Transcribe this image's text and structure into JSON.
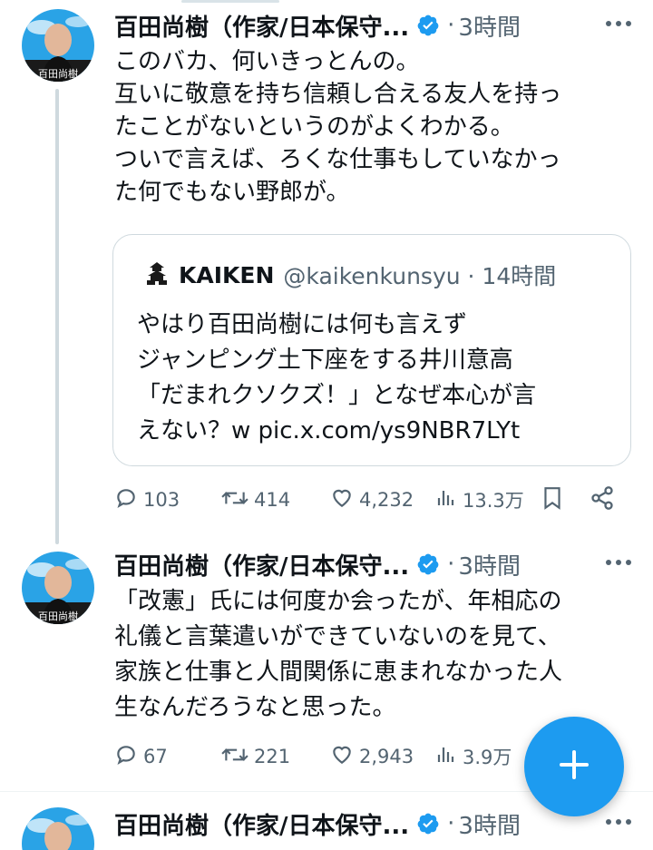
{
  "tweets": [
    {
      "author_name": "百田尚樹（作家/日本保守...",
      "time": "3時間",
      "lines": [
        "このバカ、何いきっとんの。",
        "互いに敬意を持ち信頼し合える友人を持っ",
        "たことがないというのがよくわかる。",
        "ついで言えば、ろくな仕事もしていなかっ",
        "た何でもない野郎が。"
      ],
      "quote": {
        "name": "KAIKEN",
        "handle": "@kaikenkunsyu · 14時間",
        "lines": [
          "やはり百田尚樹には何も言えず",
          "ジャンピング土下座をする井川意高",
          "「だまれクソクズ！」となぜ本心が言",
          "えない？w pic.x.com/ys9NBR7LYt"
        ]
      },
      "replies": "103",
      "retweets": "414",
      "likes": "4,232",
      "views": "13.3万"
    },
    {
      "author_name": "百田尚樹（作家/日本保守...",
      "time": "3時間",
      "lines": [
        "「改憲」氏には何度か会ったが、年相応の",
        "礼儀と言葉遣いができていないのを見て、",
        "家族と仕事と人間関係に恵まれなかった人",
        "生なんだろうなと思った。"
      ],
      "replies": "67",
      "retweets": "221",
      "likes": "2,943",
      "views": "3.9万"
    },
    {
      "author_name": "百田尚樹（作家/日本保守...",
      "time": "3時間"
    }
  ],
  "avatar_caption": "百田尚樹",
  "icons": {
    "verified": "verified-badge-icon",
    "more": "more-dots-icon",
    "reply": "reply-icon",
    "retweet": "retweet-icon",
    "like": "like-icon",
    "views": "views-icon",
    "bookmark": "bookmark-icon",
    "share": "share-icon",
    "compose": "compose-plus-icon",
    "quote_logo": "castle-icon"
  },
  "colors": {
    "accent": "#1d9bf0",
    "muted": "#536471",
    "text": "#0f1419",
    "border": "#cfd9de"
  }
}
